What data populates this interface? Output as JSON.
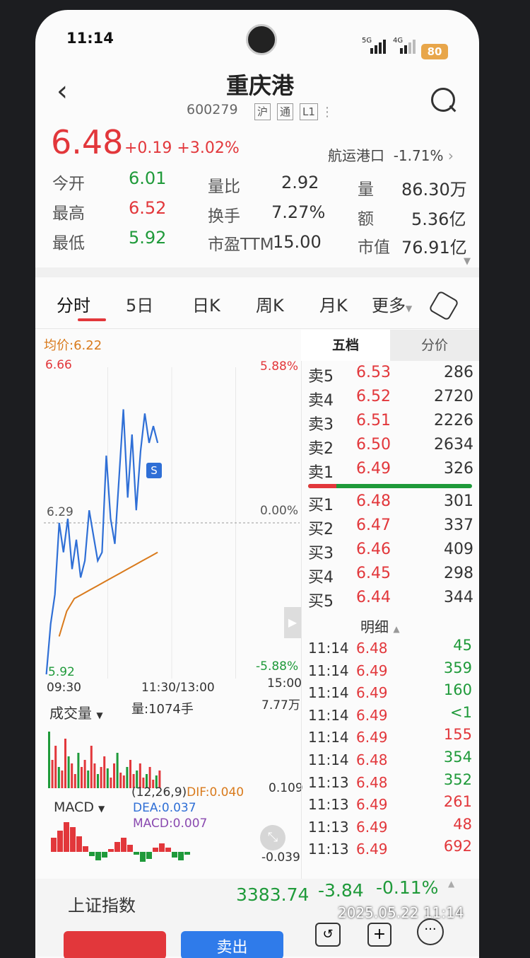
{
  "status": {
    "time": "11:14",
    "net1": "5G",
    "net2": "4G",
    "battery": "80"
  },
  "header": {
    "title": "重庆港",
    "code": "600279",
    "tags": [
      "沪",
      "通",
      "L1"
    ]
  },
  "quote": {
    "price": "6.48",
    "change": "+0.19",
    "change_pct": "+3.02%",
    "sector_name": "航运港口",
    "sector_pct": "-1.71%",
    "stats": [
      {
        "label": "今开",
        "value": "6.01",
        "color": "green"
      },
      {
        "label": "量比",
        "value": "2.92",
        "color": "dark"
      },
      {
        "label": "量",
        "value": "86.30万",
        "color": "dark"
      },
      {
        "label": "最高",
        "value": "6.52",
        "color": "red"
      },
      {
        "label": "换手",
        "value": "7.27%",
        "color": "dark"
      },
      {
        "label": "额",
        "value": "5.36亿",
        "color": "dark"
      },
      {
        "label": "最低",
        "value": "5.92",
        "color": "green"
      },
      {
        "label": "市盈TTM",
        "value": "15.00",
        "color": "dark"
      },
      {
        "label": "市值",
        "value": "76.91亿",
        "color": "dark"
      }
    ]
  },
  "tabs": [
    "分时",
    "5日",
    "日K",
    "周K",
    "月K",
    "更多"
  ],
  "chart": {
    "avg_label": "均价:6.22",
    "y_high": "6.66",
    "y_mid": "6.29",
    "y_low": "5.92",
    "pct_high": "5.88%",
    "pct_mid": "0.00%",
    "pct_low": "-5.88%",
    "time_start": "09:30",
    "time_mid": "11:30/13:00",
    "time_end": "15:00",
    "vol_label": "成交量",
    "vol_value": "量:1074手",
    "vol_max": "7.77万",
    "macd_label": "MACD",
    "macd_params": "(12,26,9)",
    "dif": "DIF:0.040",
    "dea": "DEA:0.037",
    "macd": "MACD:0.007",
    "macd_max": "0.109",
    "macd_min": "-0.039",
    "marker": "S"
  },
  "chart_data": {
    "type": "line",
    "x_range": [
      "09:30",
      "15:00"
    ],
    "ylim": [
      5.92,
      6.66
    ],
    "series": [
      {
        "values": [
          5.93,
          6.05,
          6.12,
          6.29,
          6.22,
          6.3,
          6.18,
          6.25,
          6.16,
          6.2,
          6.32,
          6.26,
          6.2,
          6.22,
          6.45,
          6.3,
          6.24,
          6.4,
          6.56,
          6.35,
          6.5,
          6.32,
          6.46,
          6.55,
          6.48,
          6.52,
          6.48
        ]
      },
      {
        "values": [
          6.02,
          6.08,
          6.11,
          6.12,
          6.13,
          6.14,
          6.15,
          6.16,
          6.17,
          6.18,
          6.19,
          6.2,
          6.21,
          6.22
        ]
      }
    ]
  },
  "orderbook": {
    "tab_active": "五档",
    "tab_other": "分价",
    "asks": [
      {
        "label": "卖5",
        "price": "6.53",
        "vol": "286"
      },
      {
        "label": "卖4",
        "price": "6.52",
        "vol": "2720"
      },
      {
        "label": "卖3",
        "price": "6.51",
        "vol": "2226"
      },
      {
        "label": "卖2",
        "price": "6.50",
        "vol": "2634"
      },
      {
        "label": "卖1",
        "price": "6.49",
        "vol": "326"
      }
    ],
    "bids": [
      {
        "label": "买1",
        "price": "6.48",
        "vol": "301"
      },
      {
        "label": "买2",
        "price": "6.47",
        "vol": "337"
      },
      {
        "label": "买3",
        "price": "6.46",
        "vol": "409"
      },
      {
        "label": "买4",
        "price": "6.45",
        "vol": "298"
      },
      {
        "label": "买5",
        "price": "6.44",
        "vol": "344"
      }
    ],
    "detail_label": "明细",
    "trades": [
      {
        "time": "11:14",
        "price": "6.48",
        "vol": "45",
        "color": "green"
      },
      {
        "time": "11:14",
        "price": "6.49",
        "vol": "359",
        "color": "green"
      },
      {
        "time": "11:14",
        "price": "6.49",
        "vol": "160",
        "color": "green"
      },
      {
        "time": "11:14",
        "price": "6.49",
        "vol": "<1",
        "color": "green"
      },
      {
        "time": "11:14",
        "price": "6.49",
        "vol": "155",
        "color": "red"
      },
      {
        "time": "11:14",
        "price": "6.48",
        "vol": "354",
        "color": "green"
      },
      {
        "time": "11:13",
        "price": "6.48",
        "vol": "352",
        "color": "green"
      },
      {
        "time": "11:13",
        "price": "6.49",
        "vol": "261",
        "color": "red"
      },
      {
        "time": "11:13",
        "price": "6.49",
        "vol": "48",
        "color": "red"
      },
      {
        "time": "11:13",
        "price": "6.49",
        "vol": "692",
        "color": "red"
      }
    ]
  },
  "index_bar": {
    "name": "上证指数",
    "value": "3383.74",
    "change": "-3.84",
    "pct": "-0.11%"
  },
  "bottom": {
    "sell_label": "卖出"
  },
  "watermark": "2025.05.22 11:14",
  "colors": {
    "up": "#e2373b",
    "down": "#1f9a3a",
    "line": "#2f6fd6",
    "avg": "#d97a1c"
  }
}
